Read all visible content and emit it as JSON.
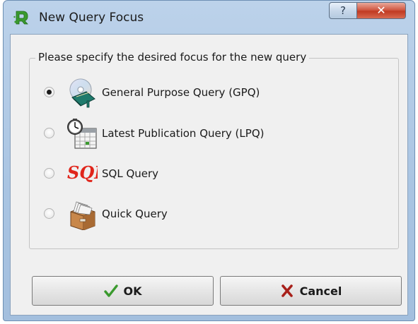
{
  "window": {
    "title": "New Query Focus",
    "help_glyph": "?",
    "close_glyph": "✕"
  },
  "group": {
    "legend": "Please specify the desired focus for the new query"
  },
  "options": [
    {
      "label": "General Purpose Query (GPQ)",
      "icon": "cd-book-icon",
      "checked": true
    },
    {
      "label": "Latest Publication Query (LPQ)",
      "icon": "clock-calendar-icon",
      "checked": false
    },
    {
      "label": "SQL Query",
      "icon": "sql-icon",
      "checked": false
    },
    {
      "label": "Quick Query",
      "icon": "file-box-icon",
      "checked": false
    }
  ],
  "buttons": {
    "ok_label": "OK",
    "cancel_label": "Cancel"
  },
  "icon_text": {
    "sql": "SQL"
  },
  "colors": {
    "accent_green": "#3a9a2e",
    "cancel_red": "#a8201a",
    "sql_red": "#e0251b"
  }
}
